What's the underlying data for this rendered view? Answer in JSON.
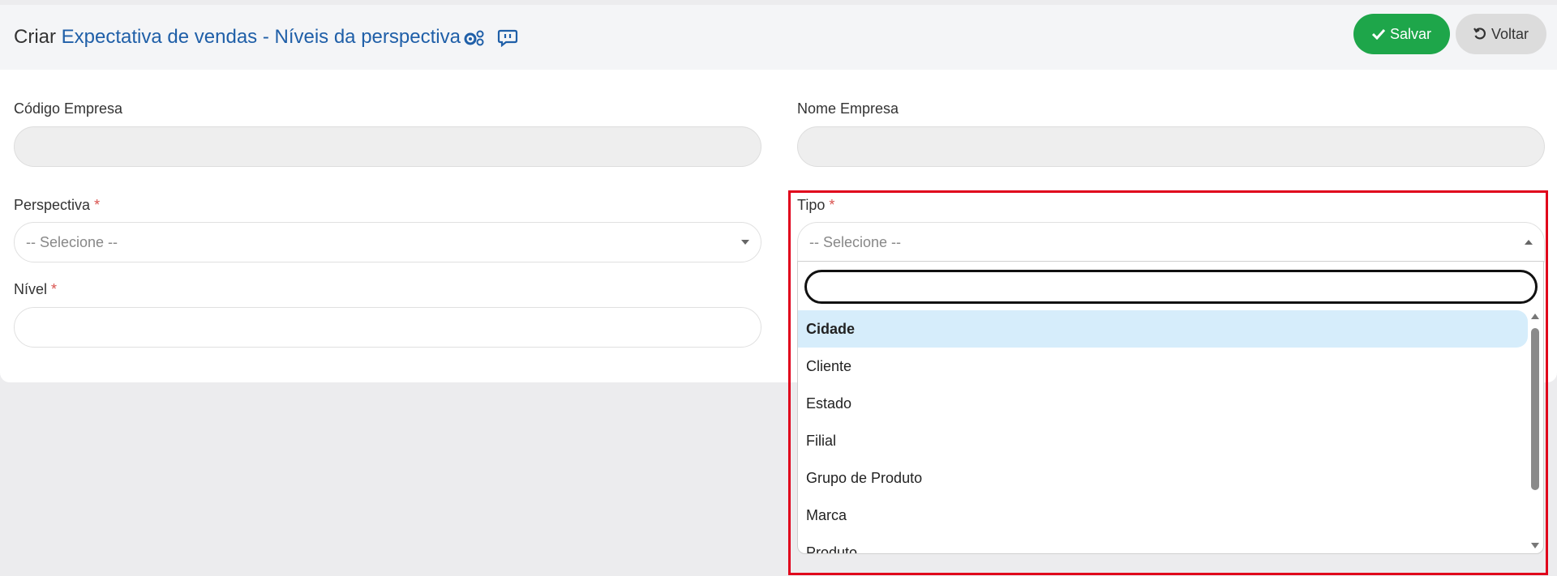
{
  "header": {
    "title_prefix": "Criar",
    "title_main": "Expectativa de vendas - Níveis da perspectiva",
    "save_label": "Salvar",
    "back_label": "Voltar",
    "icons": [
      "gears-icon",
      "chat-icon",
      "check-icon",
      "undo-icon"
    ]
  },
  "form": {
    "codigo_empresa": {
      "label": "Código Empresa",
      "value": ""
    },
    "nome_empresa": {
      "label": "Nome Empresa",
      "value": ""
    },
    "perspectiva": {
      "label": "Perspectiva",
      "required_mark": "*",
      "placeholder": "-- Selecione --"
    },
    "tipo": {
      "label": "Tipo",
      "required_mark": "*",
      "placeholder": "-- Selecione --"
    },
    "nivel": {
      "label": "Nível",
      "required_mark": "*",
      "value": ""
    }
  },
  "dropdown": {
    "search_value": "",
    "options": [
      "Cidade",
      "Cliente",
      "Estado",
      "Filial",
      "Grupo de Produto",
      "Marca",
      "Produto"
    ],
    "highlighted_option": "Cidade"
  },
  "colors": {
    "accent_blue": "#1f5fa8",
    "save_green": "#1ea64a",
    "highlight_red": "#e0001b",
    "option_hover": "#d6edfb"
  }
}
